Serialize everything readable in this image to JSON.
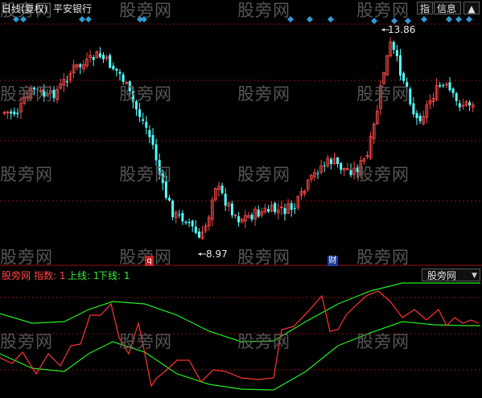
{
  "header": {
    "period_label": "日线(复权)",
    "security_name": "平安银行",
    "btn_indicator": "指",
    "btn_info": "信息"
  },
  "main_chart": {
    "high_annotation": "13.86",
    "low_annotation": "8.97",
    "event_badges": [
      "q",
      "财"
    ],
    "colors": {
      "up": "#ff4a4a",
      "down": "#54ffff",
      "grid": "#8a1010",
      "diamond": "#2f9bd4"
    }
  },
  "sub_chart": {
    "name": "股旁网",
    "index_label": "指数: 1",
    "upper_label": "上线: 1",
    "lower_label": "下线: 1",
    "selector_value": "股旁网",
    "colors": {
      "index": "#ff3333",
      "bands": "#22ee22"
    }
  },
  "watermark": "股旁网"
}
